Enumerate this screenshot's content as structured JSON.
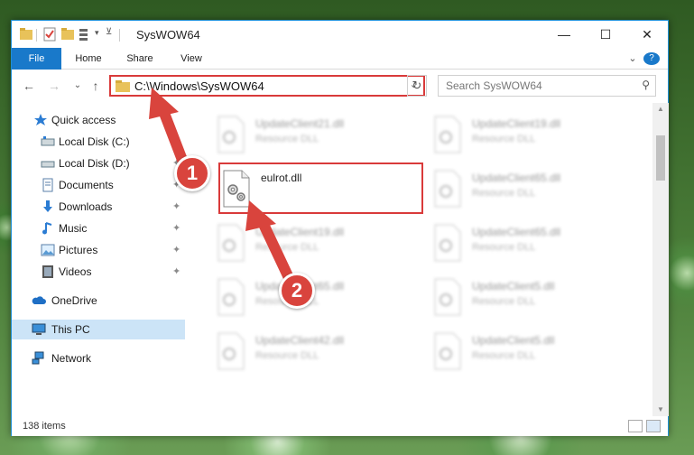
{
  "window": {
    "title": "SysWOW64",
    "minimize": "—",
    "maximize": "☐",
    "close": "✕"
  },
  "ribbon": {
    "tabs": [
      {
        "label": "File"
      },
      {
        "label": "Home"
      },
      {
        "label": "Share"
      },
      {
        "label": "View"
      }
    ],
    "chevron": "⌄",
    "help": "?"
  },
  "nav": {
    "back": "←",
    "forward": "→",
    "recent": "⌄",
    "up": "↑",
    "address_path": "C:\\Windows\\SysWOW64",
    "address_dropdown": "⌄",
    "refresh": "↻",
    "search_placeholder": "Search SysWOW64",
    "search_icon": "⚲"
  },
  "sidebar": {
    "items": [
      {
        "label": "Quick access",
        "icon": "star-icon",
        "pinned": false
      },
      {
        "label": "Local Disk (C:)",
        "icon": "drive-icon",
        "pinned": true
      },
      {
        "label": "Local Disk (D:)",
        "icon": "drive-icon",
        "pinned": true
      },
      {
        "label": "Documents",
        "icon": "documents-icon",
        "pinned": true
      },
      {
        "label": "Downloads",
        "icon": "download-icon",
        "pinned": true
      },
      {
        "label": "Music",
        "icon": "music-icon",
        "pinned": true
      },
      {
        "label": "Pictures",
        "icon": "pictures-icon",
        "pinned": true
      },
      {
        "label": "Videos",
        "icon": "videos-icon",
        "pinned": true
      },
      {
        "label": "OneDrive",
        "icon": "cloud-icon",
        "pinned": false
      },
      {
        "label": "This PC",
        "icon": "computer-icon",
        "pinned": false,
        "selected": true
      },
      {
        "label": "Network",
        "icon": "network-icon",
        "pinned": false
      }
    ],
    "pin_glyph": "📌"
  },
  "files": [
    {
      "name": "UpdateClient21.dll",
      "type": "Resource DLL"
    },
    {
      "name": "UpdateClient19.dll",
      "type": "Resource DLL"
    },
    {
      "name": "eulrot.dll",
      "type": ""
    },
    {
      "name": "UpdateClient65.dll",
      "type": "Resource DLL"
    },
    {
      "name": "UpdateClient19.dll",
      "type": "Resource DLL"
    },
    {
      "name": "UpdateClient65.dll",
      "type": "Resource DLL"
    },
    {
      "name": "UpdateClient65.dll",
      "type": "Resource DLL"
    },
    {
      "name": "UpdateClient5.dll",
      "type": "Resource DLL"
    },
    {
      "name": "UpdateClient42.dll",
      "type": "Resource DLL"
    },
    {
      "name": "UpdateClient5.dll",
      "type": "Resource DLL"
    }
  ],
  "status": {
    "item_count": "138 items"
  },
  "annotations": {
    "step1": "1",
    "step2": "2",
    "color": "#d9443d"
  }
}
